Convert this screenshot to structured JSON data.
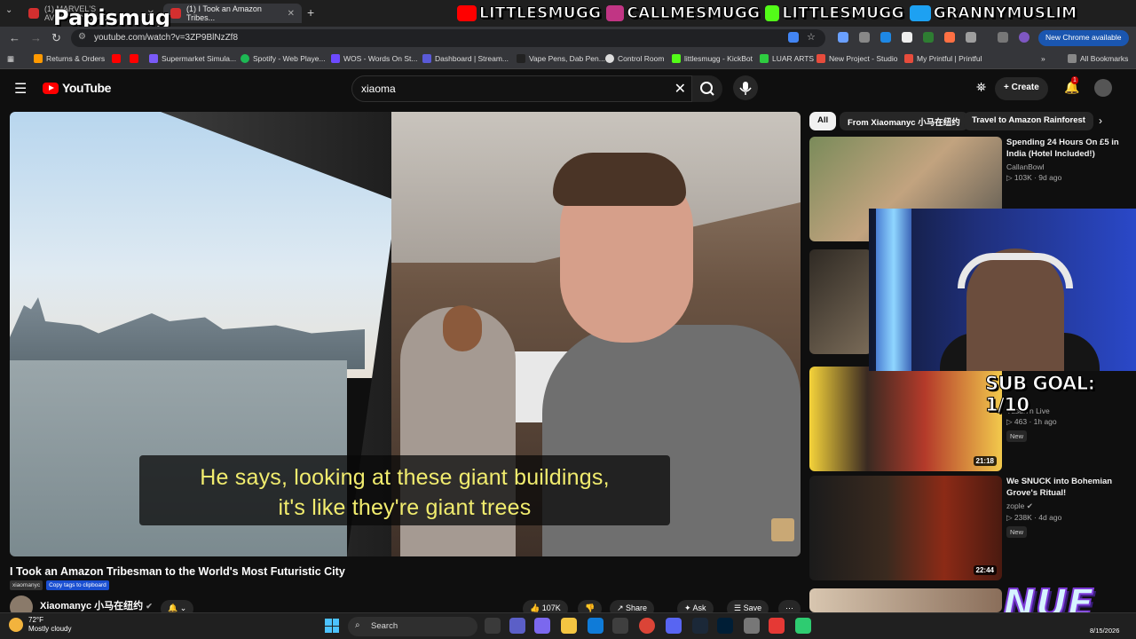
{
  "browser": {
    "tabs": [
      {
        "label": "(1) MARVEL'S AVENGERS 5 - D..."
      },
      {
        "label": "(1) I Took an Amazon Tribes..."
      }
    ],
    "url": "youtube.com/watch?v=3ZP9BlNzZf8",
    "new_chrome_label": "New Chrome available",
    "bookmarks": [
      {
        "label": "Returns & Orders",
        "color": "#ff9900"
      },
      {
        "label": "Supermarket Simula...",
        "color": "#7a5af8"
      },
      {
        "label": "Spotify - Web Playe...",
        "color": "#1db954"
      },
      {
        "label": "WOS - Words On St...",
        "color": "#6d4aff"
      },
      {
        "label": "Dashboard | Stream...",
        "color": "#5a5ad8"
      },
      {
        "label": "Vape Pens, Dab Pen...",
        "color": "#222222"
      },
      {
        "label": "Control Room",
        "color": "#dddddd"
      },
      {
        "label": "littlesmugg - KickBot",
        "color": "#53fc18"
      },
      {
        "label": "LUAR ARTS",
        "color": "#2ecc40"
      },
      {
        "label": "New Project - Studio",
        "color": "#e74c3c"
      },
      {
        "label": "My Printful | Printful",
        "color": "#e74c3c"
      }
    ],
    "all_bookmarks_label": "All Bookmarks"
  },
  "youtube": {
    "logo_text": "YouTube",
    "search_value": "xiaoma",
    "create_label": "Create",
    "notification_count": "1"
  },
  "video": {
    "subtitle_line1": "He says, looking at these giant buildings,",
    "subtitle_line2": "it's like they're giant trees",
    "title": "I Took an Amazon Tribesman to the World's Most Futuristic City",
    "tag1": "xiaomanyc",
    "tag2": "Copy tags to clipboard",
    "channel_name": "Xiaomanyc 小马在纽约",
    "likes": "107K",
    "share_label": "Share",
    "ask_label": "Ask",
    "save_label": "Save"
  },
  "chips": [
    {
      "label": "All"
    },
    {
      "label": "From Xiaomanyc 小马在纽约"
    },
    {
      "label": "Travel to Amazon Rainforest"
    }
  ],
  "recommendations": [
    {
      "title": "Spending 24 Hours On £5 in India (Hotel Included!)",
      "channel": "CallanBowl",
      "stats": "103K · 9d ago",
      "duration": "",
      "new": false
    },
    {
      "title": "",
      "channel": "",
      "stats": "",
      "duration": "",
      "new": false
    },
    {
      "title": "...",
      "channel": "Yusuf7n Live",
      "stats": "463 · 1h ago",
      "duration": "21:18",
      "new": true
    },
    {
      "title": "We SNUCK into Bohemian Grove's Ritual!",
      "channel": "zople",
      "stats": "238K · 4d ago",
      "duration": "22:44",
      "new": true
    }
  ],
  "overlay": {
    "streamer_name": "Papismug",
    "handles": [
      {
        "icon": "youtube-icon",
        "color": "#ff0000",
        "text": "LITTLESMUGG"
      },
      {
        "icon": "instagram-icon",
        "color": "#c13584",
        "text": "CALLMESMUGG"
      },
      {
        "icon": "kick-icon",
        "color": "#53fc18",
        "text": "LITTLESMUGG"
      },
      {
        "icon": "twitter-icon",
        "color": "#1da1f2",
        "text": "GRANNYMUSLIM"
      }
    ],
    "sub_goal": "SUB GOAL: 1/10",
    "logo_text": "NUE"
  },
  "taskbar": {
    "temperature": "72°F",
    "weather": "Mostly cloudy",
    "search_label": "Search",
    "date": "8/15/2026"
  }
}
